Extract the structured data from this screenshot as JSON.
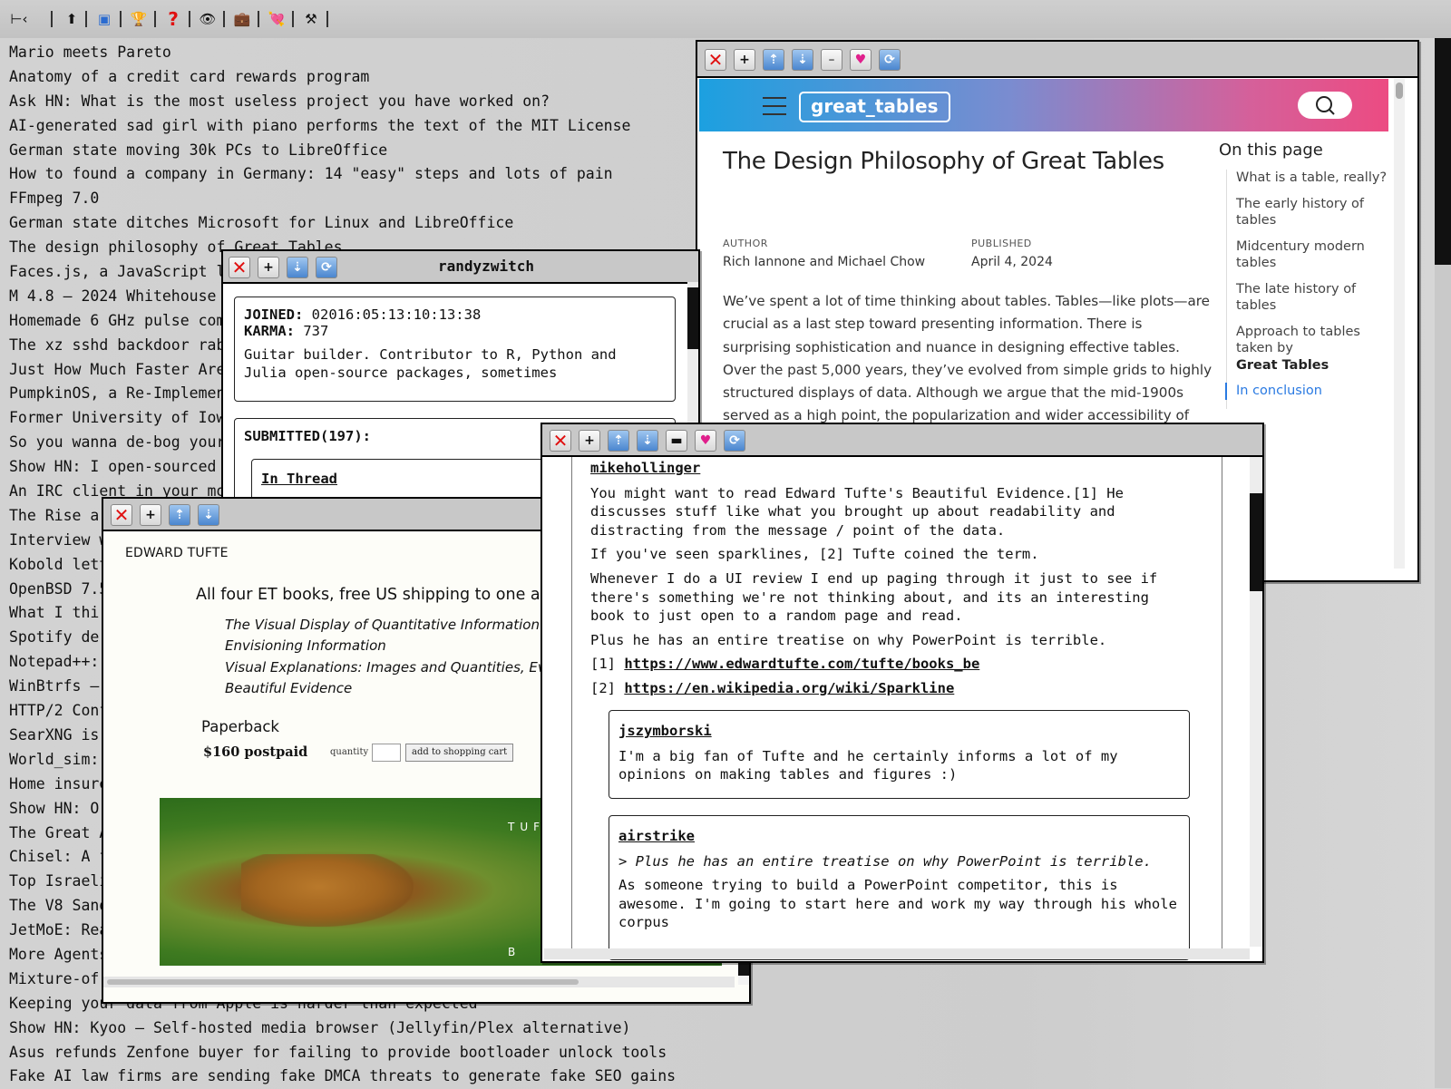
{
  "toolbar": {
    "items": [
      {
        "name": "hn-logo-icon",
        "glyph": "⊢‹"
      },
      {
        "name": "top-icon",
        "glyph": "⬆"
      },
      {
        "name": "new-icon",
        "glyph": "▣"
      },
      {
        "name": "trophy-icon",
        "glyph": "🏆"
      },
      {
        "name": "question-icon",
        "glyph": "?"
      },
      {
        "name": "eye-icon",
        "glyph": "👁"
      },
      {
        "name": "briefcase-icon",
        "glyph": "💼"
      },
      {
        "name": "heart-arrow-icon",
        "glyph": "💘"
      },
      {
        "name": "tools-icon",
        "glyph": "⚒"
      }
    ]
  },
  "headlines": [
    "Mario meets Pareto",
    "Anatomy of a credit card rewards program",
    "Ask HN: What is the most useless project you have worked on?",
    "AI-generated sad girl with piano performs the text of the MIT License",
    "German state moving 30k PCs to LibreOffice",
    "How to found a company in Germany: 14 \"easy\" steps and lots of pain",
    "FFmpeg 7.0",
    "German state ditches Microsoft for Linux and LibreOffice",
    "The design philosophy of Great Tables",
    "Faces.js, a JavaScript l",
    "M 4.8 – 2024 Whitehouse S",
    "Homemade 6 GHz pulse comp",
    "The xz sshd backdoor rabb",
    "Just How Much Faster Are",
    "PumpkinOS, a Re-Implement",
    "Former University of Iowa",
    "So you wanna de-bog yours",
    "Show HN: I open-sourced t",
    "An IRC client in your mot",
    "The Rise ar",
    "Interview w",
    "Kobold lett",
    "OpenBSD 7.5",
    "What I thir",
    "Spotify der",
    "Notepad++:",
    "WinBtrfs –",
    "HTTP/2 Conf",
    "SearXNG is",
    "World_sim:",
    "Home insure",
    "Show HN: Or",
    "The Great A",
    "Chisel: A f",
    "Top Israeli",
    "The V8 Sand",
    "JetMoE: Rea",
    "More Agents",
    "Mixture-of-",
    "Keeping your data from Apple is harder than expected",
    "Show HN: Kyoo – Self-hosted media browser (Jellyfin/Plex alternative)",
    "Asus refunds Zenfone buyer for failing to provide bootloader unlock tools",
    "Fake AI law firms are sending fake DMCA threats to generate fake SEO gains"
  ],
  "great_tables_window": {
    "brand": "great_tables",
    "title": "The Design Philosophy of Great Tables",
    "author_label": "AUTHOR",
    "author": "Rich Iannone and Michael Chow",
    "published_label": "PUBLISHED",
    "published": "April 4, 2024",
    "body": "We’ve spent a lot of time thinking about tables. Tables—like plots—are crucial as a last step toward presenting information. There is surprising sophistication and nuance in designing effective tables. Over the past 5,000 years, they’ve evolved from simple grids to highly structured displays of data. Although we argue that the mid-1900s served as a high point, the popularization and wider accessibility of computing seemingly brought us back to the simple, ancient times.",
    "toc_title": "On this page",
    "toc": [
      "What is a table, really?",
      "The early history of tables",
      "Midcentury modern tables",
      "The late history of tables",
      "Approach to tables taken by",
      "Great Tables",
      "In conclusion"
    ]
  },
  "user_window": {
    "title": "randyzwitch",
    "joined_label": "JOINED:",
    "joined": "02016:05:13:10:13:38",
    "karma_label": "KARMA:",
    "karma": "737",
    "about": "Guitar builder. Contributor to R, Python and Julia open-source packages, sometimes",
    "submitted_label": "SUBMITTED(197):",
    "thread_link": "In Thread"
  },
  "tufte_window": {
    "brand": "EDWARD TUFTE",
    "headline": "All four ET books, free US shipping to one addr",
    "books": [
      "The Visual Display of Quantitative Information",
      "Envisioning Information",
      "Visual Explanations: Images and Quantities, Evide",
      "Beautiful Evidence"
    ],
    "format": "Paperback",
    "price": "$160 postpaid",
    "quantity_label": "quantity",
    "cart_button": "add to shopping cart",
    "spine_text": "TUFTE",
    "spine_tail": "B"
  },
  "comments_window": {
    "main": {
      "user": "mikehollinger",
      "paragraphs": [
        "You might want to read Edward Tufte's Beautiful Evidence.[1] He discusses stuff like what you brought up about readability and distracting from the message / point of the data.",
        "If you've seen sparklines, [2] Tufte coined the term.",
        "Whenever I do a UI review I end up paging through it just to see if there's something we're not thinking about, and its an interesting book to just open to a random page and read.",
        "Plus he has an entire treatise on why PowerPoint is terrible."
      ],
      "refs": [
        {
          "num": "[1]",
          "url": "https://www.edwardtufte.com/tufte/books_be"
        },
        {
          "num": "[2]",
          "url": "https://en.wikipedia.org/wiki/Sparkline"
        }
      ]
    },
    "replies": [
      {
        "user": "jszymborski",
        "text": "I'm a big fan of Tufte and he certainly informs a lot of my opinions on making tables and figures :)"
      },
      {
        "user": "airstrike",
        "quote": "> Plus he has an entire treatise on why PowerPoint is terrible.",
        "text": "As someone trying to build a PowerPoint competitor, this is awesome. I'm going to start here and work my way through his whole corpus"
      }
    ]
  },
  "colors": {
    "close": "#e01010",
    "gt_gradient_start": "#1ca0e0",
    "gt_gradient_end": "#ec4b82",
    "toc_active": "#2a7ae2"
  }
}
